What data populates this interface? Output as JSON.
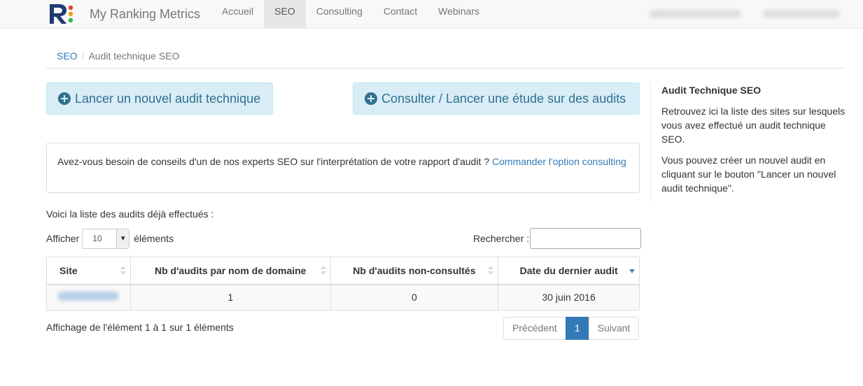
{
  "brand": {
    "name": "My Ranking Metrics"
  },
  "nav": {
    "items": [
      {
        "label": "Accueil",
        "active": false
      },
      {
        "label": "SEO",
        "active": true
      },
      {
        "label": "Consulting",
        "active": false
      },
      {
        "label": "Contact",
        "active": false
      },
      {
        "label": "Webinars",
        "active": false
      }
    ]
  },
  "breadcrumb": {
    "parent": "SEO",
    "separator": "/",
    "current": "Audit technique SEO"
  },
  "actions": {
    "new_audit": "Lancer un nouvel audit technique",
    "study": "Consulter / Lancer une étude sur des audits"
  },
  "panel": {
    "text": "Avez-vous besoin de conseils d'un de nos experts SEO sur l'interprétation de votre rapport d'audit ? ",
    "link": "Commander l'option consulting"
  },
  "intro": "Voici la liste des audits déjà effectués :",
  "length": {
    "before": "Afficher",
    "value": "10",
    "after": "éléments"
  },
  "search": {
    "label": "Rechercher :",
    "value": ""
  },
  "table": {
    "headers": [
      "Site",
      "Nb d'audits par nom de domaine",
      "Nb d'audits non-consultés",
      "Date du dernier audit"
    ],
    "rows": [
      {
        "site": "",
        "nb_audits": "1",
        "non_consultes": "0",
        "date": "30 juin 2016"
      }
    ]
  },
  "info": "Affichage de l'élément 1 à 1 sur 1 éléments",
  "pagination": {
    "prev": "Précédent",
    "current": "1",
    "next": "Suivant"
  },
  "sidebar": {
    "title": "Audit Technique SEO",
    "p1": "Retrouvez ici la liste des sites sur lesquels vous avez effectué un audit technique SEO.",
    "p2": "Vous pouvez créer un nouvel audit en cliquant sur le bouton \"Lancer un nouvel audit technique\"."
  },
  "colors": {
    "accent": "#337ab7",
    "info_bg": "#d9edf7",
    "info_text": "#31708f",
    "logo_navy": "#1f3b73",
    "logo_red": "#e43d2f",
    "logo_orange": "#f39c12",
    "logo_green": "#3cb44a"
  }
}
